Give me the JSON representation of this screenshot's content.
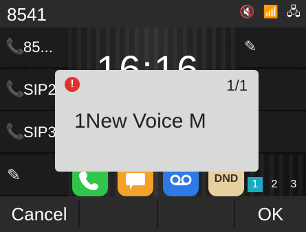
{
  "header": {
    "account_label": "8541",
    "icons": [
      "mute-icon",
      "wifi-icon",
      "network-icon"
    ]
  },
  "left_keys": [
    {
      "label": "85...",
      "icon": "phone-icon"
    },
    {
      "label": "SIP2",
      "icon": "phone-icon"
    },
    {
      "label": "SIP3",
      "icon": "phone-icon"
    },
    {
      "label": "",
      "icon": "edit-icon"
    }
  ],
  "right_keys": [
    {
      "icon": "edit-icon"
    },
    {
      "icon": "edit-icon"
    },
    {
      "icon": "edit-icon"
    }
  ],
  "time": "16:16",
  "apps": [
    {
      "name": "phone",
      "label": ""
    },
    {
      "name": "messages",
      "label": ""
    },
    {
      "name": "voicemail",
      "label": ""
    },
    {
      "name": "dnd",
      "label": "DND"
    }
  ],
  "pages": [
    "1",
    "2",
    "3"
  ],
  "popup": {
    "count": "1/1",
    "message": "1New Voice M"
  },
  "softkeys": [
    "Cancel",
    "",
    "",
    "OK"
  ],
  "colors": {
    "accent": "#19a9c0",
    "alert": "#e0322f",
    "phone_icon": "#19b4b4"
  }
}
